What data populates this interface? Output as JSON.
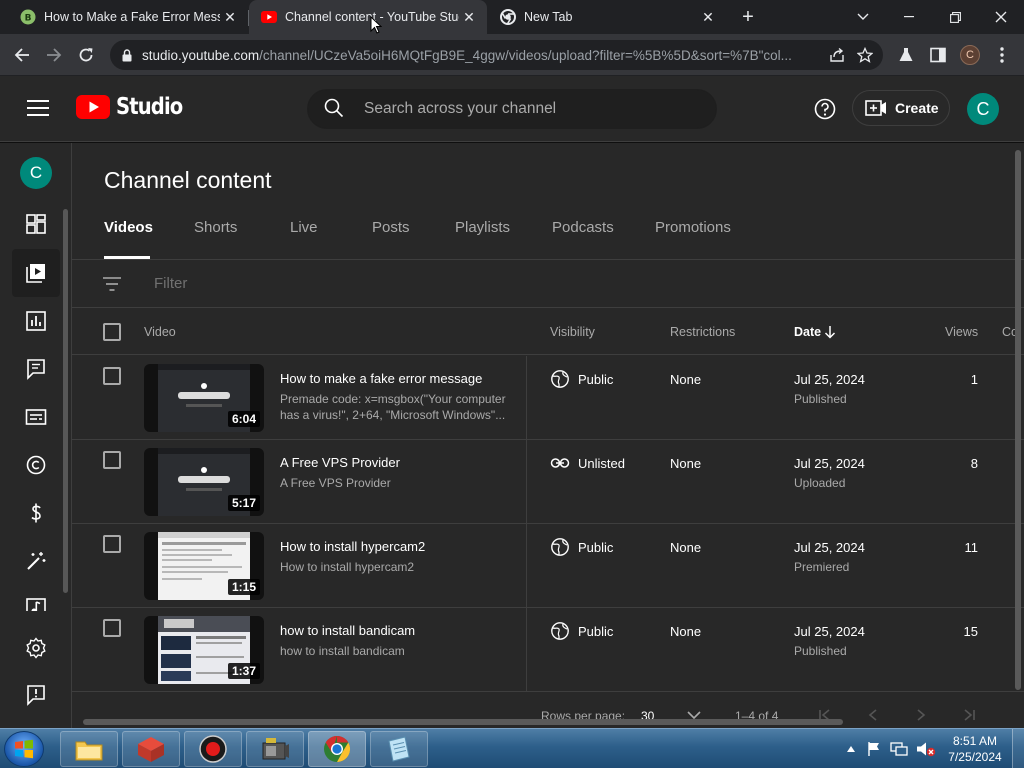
{
  "browser": {
    "tabs": [
      {
        "title": "How to Make a Fake Error Messa",
        "active": false
      },
      {
        "title": "Channel content - YouTube Stud",
        "active": true
      },
      {
        "title": "New Tab",
        "active": false
      }
    ],
    "url_host": "studio.youtube.com",
    "url_path": "/channel/UCzeVa5oiH6MQtFgB9E_4ggw/videos/upload?filter=%5B%5D&sort=%7B\"col...",
    "profile_initial": "C"
  },
  "header": {
    "logo_text": "Studio",
    "search_placeholder": "Search across your channel",
    "create_label": "Create",
    "avatar_initial": "C"
  },
  "sidebar": {
    "avatar_initial": "C",
    "items": [
      {
        "icon": "dashboard-icon"
      },
      {
        "icon": "content-icon",
        "selected": true
      },
      {
        "icon": "analytics-icon"
      },
      {
        "icon": "comments-icon"
      },
      {
        "icon": "subtitles-icon"
      },
      {
        "icon": "copyright-icon"
      },
      {
        "icon": "earn-icon"
      },
      {
        "icon": "customization-icon"
      },
      {
        "icon": "audio-library-icon"
      },
      {
        "icon": "settings-icon"
      },
      {
        "icon": "feedback-icon"
      }
    ]
  },
  "main": {
    "title": "Channel content",
    "tabs": [
      "Videos",
      "Shorts",
      "Live",
      "Posts",
      "Playlists",
      "Podcasts",
      "Promotions"
    ],
    "active_tab": "Videos",
    "filter_placeholder": "Filter",
    "columns": {
      "video": "Video",
      "visibility": "Visibility",
      "restrictions": "Restrictions",
      "date": "Date",
      "views": "Views",
      "comments": "Co"
    },
    "rows": [
      {
        "title": "How to make a fake error message",
        "description": "Premade code: x=msgbox(\"Your computer has a virus!\", 2+64, \"Microsoft Windows\"...",
        "duration": "6:04",
        "visibility": "Public",
        "visibility_icon": "globe-icon",
        "restrictions": "None",
        "date": "Jul 25, 2024",
        "status": "Published",
        "views": "1"
      },
      {
        "title": "A Free VPS Provider",
        "description": "A Free VPS Provider",
        "duration": "5:17",
        "visibility": "Unlisted",
        "visibility_icon": "link-icon",
        "restrictions": "None",
        "date": "Jul 25, 2024",
        "status": "Uploaded",
        "views": "8"
      },
      {
        "title": "How to install hypercam2",
        "description": "How to install hypercam2",
        "duration": "1:15",
        "visibility": "Public",
        "visibility_icon": "globe-icon",
        "restrictions": "None",
        "date": "Jul 25, 2024",
        "status": "Premiered",
        "views": "11"
      },
      {
        "title": "how to install bandicam",
        "description": "how to install bandicam",
        "duration": "1:37",
        "visibility": "Public",
        "visibility_icon": "globe-icon",
        "restrictions": "None",
        "date": "Jul 25, 2024",
        "status": "Published",
        "views": "15"
      }
    ],
    "pager": {
      "rows_label": "Rows per page:",
      "rows_value": "30",
      "range": "1–4 of 4"
    }
  },
  "taskbar": {
    "time": "8:51 AM",
    "date": "7/25/2024"
  },
  "colors": {
    "youtube_red": "#ff0000",
    "avatar_teal": "#00897b",
    "studio_bg": "#282828"
  }
}
